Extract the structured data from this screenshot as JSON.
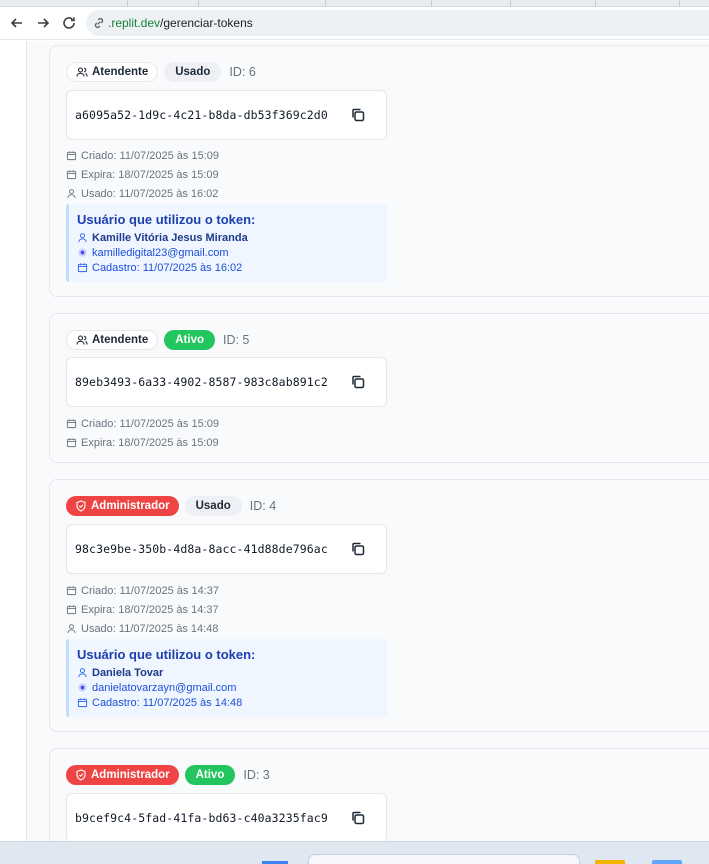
{
  "browser": {
    "url_host": ".replit.dev",
    "url_path": "/gerenciar-tokens"
  },
  "labels": {
    "created_prefix": "Criado:",
    "expires_prefix": "Expira:",
    "used_prefix": "Usado:",
    "user_box_title": "Usuário que utilizou o token:",
    "signup_prefix": "Cadastro:"
  },
  "tokens": [
    {
      "role": "Atendente",
      "status": "Usado",
      "id": "ID: 6",
      "token": "a6095a52-1d9c-4c21-b8da-db53f369c2d0",
      "created": "Criado: 11/07/2025 às 15:09",
      "expires": "Expira: 18/07/2025 às 15:09",
      "used": "Usado: 11/07/2025 às 16:02",
      "user": {
        "title": "Usuário que utilizou o token:",
        "name": "Kamille Vitória Jesus Miranda",
        "email": "kamilledigital23@gmail.com",
        "signup": "Cadastro: 11/07/2025 às 16:02"
      }
    },
    {
      "role": "Atendente",
      "status": "Ativo",
      "id": "ID: 5",
      "token": "89eb3493-6a33-4902-8587-983c8ab891c2",
      "created": "Criado: 11/07/2025 às 15:09",
      "expires": "Expira: 18/07/2025 às 15:09"
    },
    {
      "role": "Administrador",
      "status": "Usado",
      "id": "ID: 4",
      "token": "98c3e9be-350b-4d8a-8acc-41d88de796ac",
      "created": "Criado: 11/07/2025 às 14:37",
      "expires": "Expira: 18/07/2025 às 14:37",
      "used": "Usado: 11/07/2025 às 14:48",
      "user": {
        "title": "Usuário que utilizou o token:",
        "name": "Daniela Tovar",
        "email": "danielatovarzayn@gmail.com",
        "signup": "Cadastro: 11/07/2025 às 14:48"
      }
    },
    {
      "role": "Administrador",
      "status": "Ativo",
      "id": "ID: 3",
      "token": "b9cef9c4-5fad-41fa-bd63-c40a3235fac9"
    }
  ],
  "colors": {
    "admin_badge": "#ef4444",
    "active_badge": "#22c55e",
    "used_badge": "#eef0f5",
    "user_box_bg": "#eff6ff",
    "user_text": "#1e40af"
  }
}
